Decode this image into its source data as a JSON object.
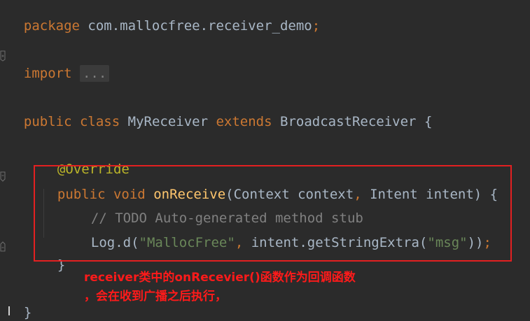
{
  "code": {
    "line1": {
      "kw_package": "package",
      "pkg_name": "com.mallocfree.receiver_demo",
      "semicolon": ";"
    },
    "line2": {
      "kw_import": "import",
      "folded": "..."
    },
    "line3": {
      "kw_public": "public",
      "kw_class": "class",
      "class_name": "MyReceiver",
      "kw_extends": "extends",
      "super_name": "BroadcastReceiver",
      "brace": "{"
    },
    "line4": {
      "annotation": "@Override"
    },
    "line5": {
      "kw_public": "public",
      "kw_void": "void",
      "method": "onReceive",
      "params_a": "(Context context",
      "comma": ",",
      "params_b": " Intent intent) {"
    },
    "line6": {
      "comment": "// TODO Auto-generated method stub"
    },
    "line7": {
      "call_a": "Log.d(",
      "str_a": "\"MallocFree\"",
      "comma": ",",
      "call_b": " intent.getStringExtra(",
      "str_b": "\"msg\"",
      "call_c": "))",
      "semicolon": ";"
    },
    "line8": {
      "brace": "}"
    },
    "line9": {
      "brace": "}"
    }
  },
  "annotation_note": {
    "line1": "receiver类中的onRecevier()函数作为回调函数",
    "line2": "，会在收到广播之后执行，"
  },
  "colors": {
    "background": "#2b2b2b",
    "keyword": "#cc7832",
    "string": "#6a8759",
    "annotation": "#bbb529",
    "method": "#ffc66d",
    "comment": "#808080",
    "highlight_border": "#e32021",
    "note_text": "#ff1a1a"
  },
  "icons": [
    "fold-icon",
    "fold-end-icon",
    "fold-start-icon"
  ]
}
